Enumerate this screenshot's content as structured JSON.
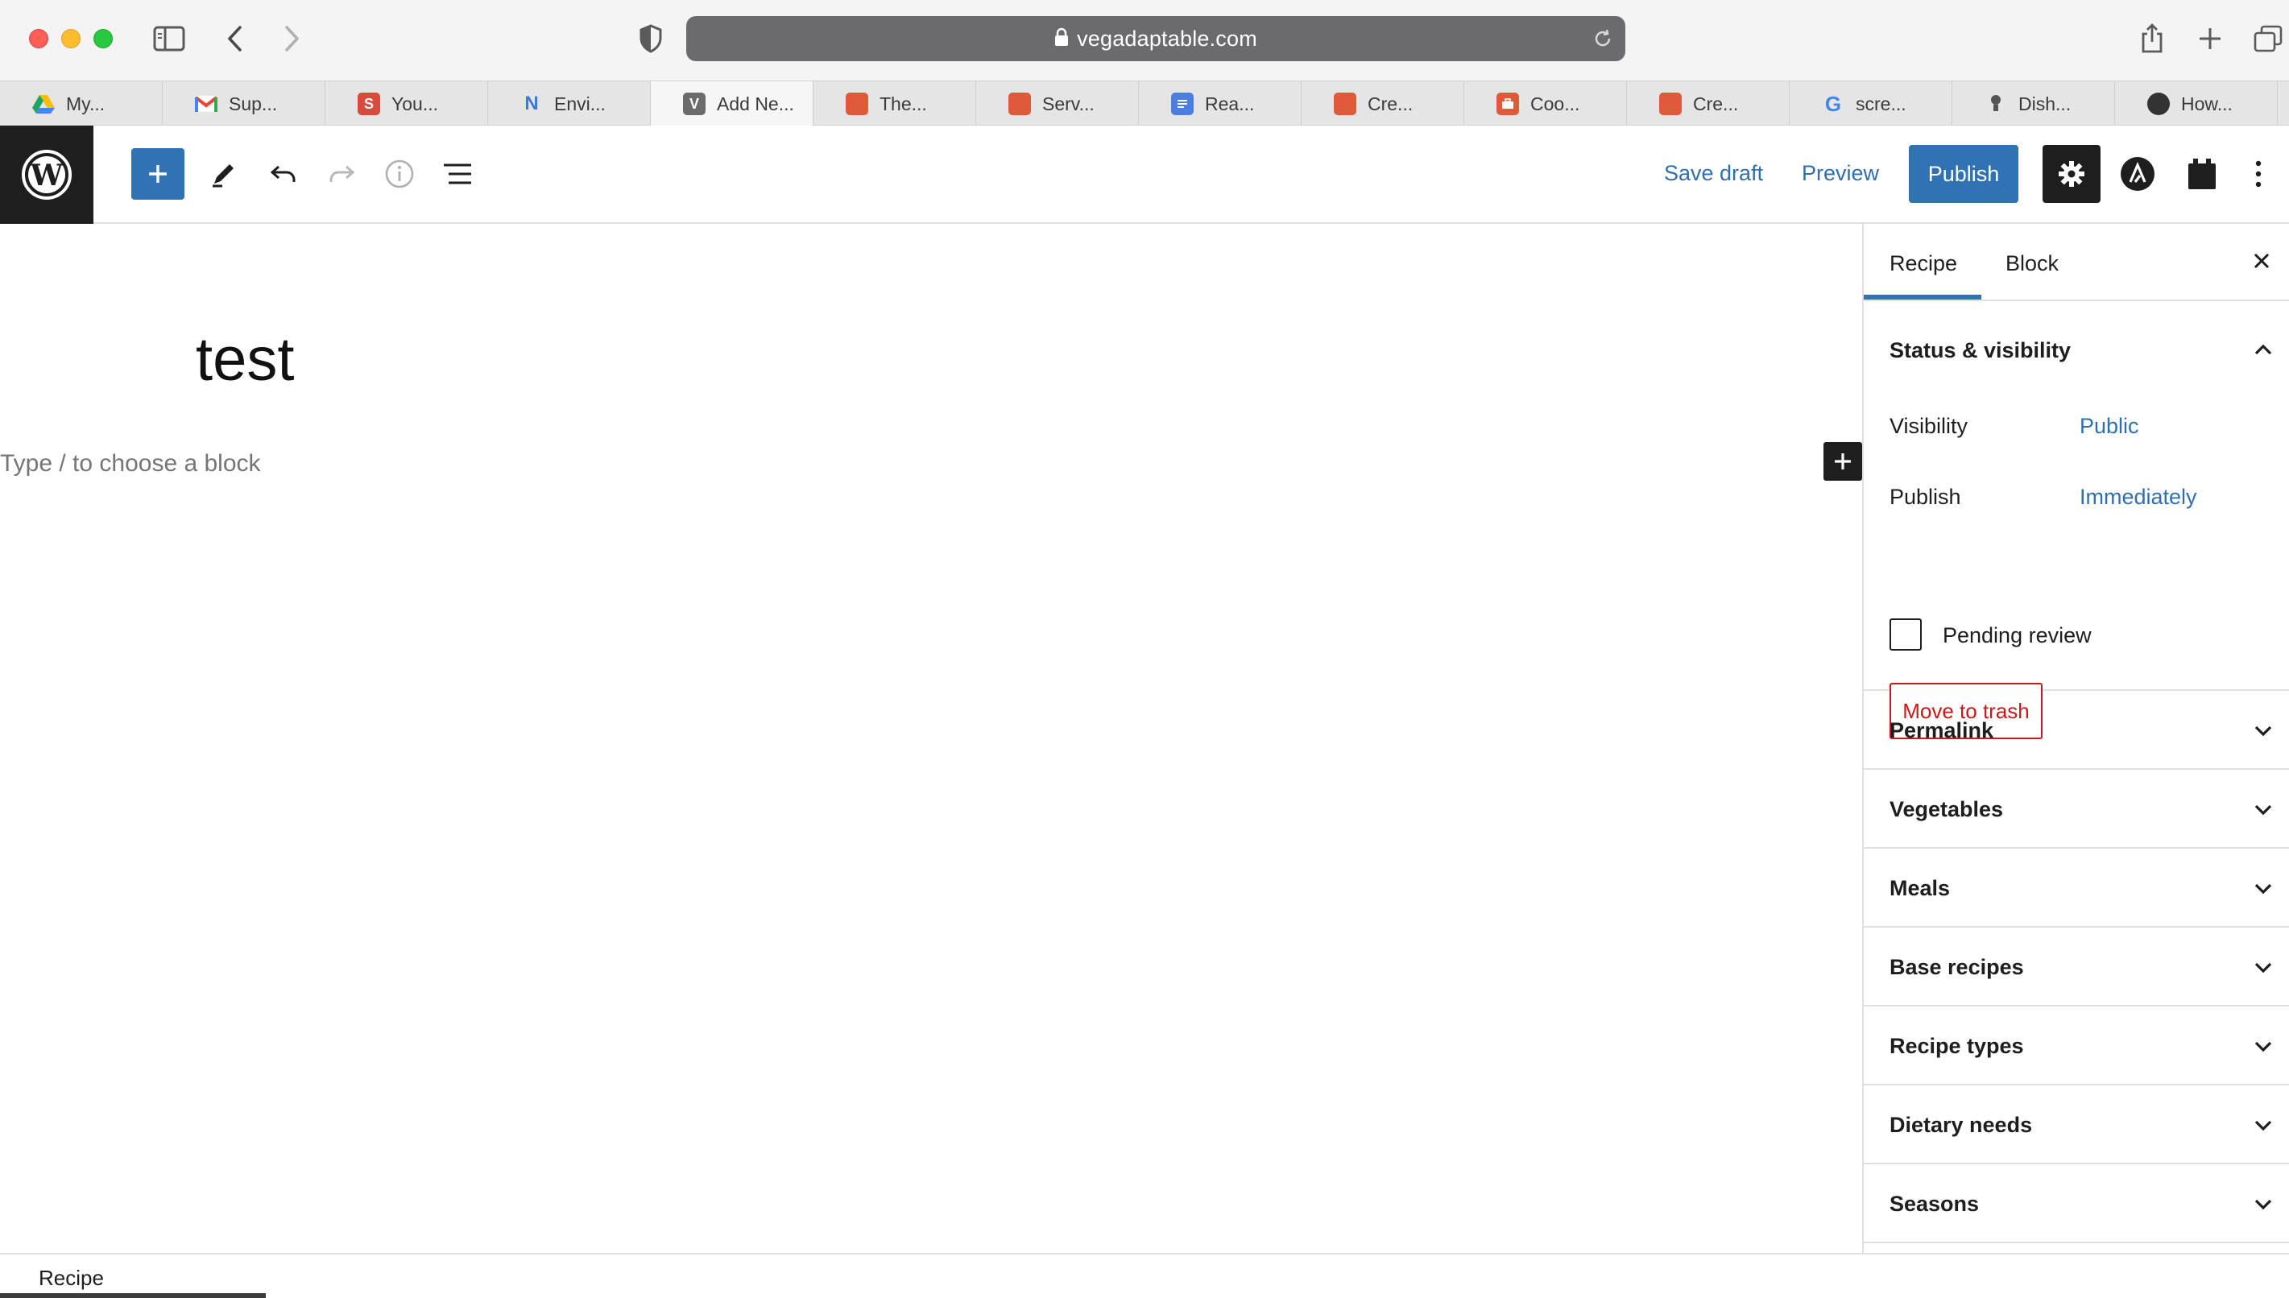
{
  "browser": {
    "url": "vegadaptable.com",
    "tabs": [
      {
        "label": "My...",
        "favicon": "google-drive-icon",
        "color": "#1fa463"
      },
      {
        "label": "Sup...",
        "favicon": "gmail-icon",
        "color": "#ea4335"
      },
      {
        "label": "You...",
        "favicon": "s-icon",
        "color": "#d94a3a"
      },
      {
        "label": "Envi...",
        "favicon": "n-icon",
        "color": "#3b7bd8"
      },
      {
        "label": "Add Ne...",
        "favicon": "v-icon",
        "color": "#6b6b6b"
      },
      {
        "label": "The...",
        "favicon": "calendar-icon",
        "color": "#e05a3a"
      },
      {
        "label": "Serv...",
        "favicon": "calendar-icon",
        "color": "#e05a3a"
      },
      {
        "label": "Rea...",
        "favicon": "docs-icon",
        "color": "#4a7ee3"
      },
      {
        "label": "Cre...",
        "favicon": "calendar-icon",
        "color": "#e05a3a"
      },
      {
        "label": "Coo...",
        "favicon": "briefcase-icon",
        "color": "#e05a3a"
      },
      {
        "label": "Cre...",
        "favicon": "calendar-icon",
        "color": "#e05a3a"
      },
      {
        "label": "scre...",
        "favicon": "google-icon",
        "color": "#4285f4"
      },
      {
        "label": "Dish...",
        "favicon": "bulb-icon",
        "color": "#555555"
      },
      {
        "label": "How...",
        "favicon": "circle-logo-icon",
        "color": "#333333"
      }
    ]
  },
  "header": {
    "save_draft": "Save draft",
    "preview": "Preview",
    "publish": "Publish"
  },
  "editor": {
    "title": "test",
    "placeholder": "Type / to choose a block"
  },
  "sidebar": {
    "tabs": [
      "Recipe",
      "Block"
    ],
    "status": {
      "title": "Status & visibility",
      "visibility_label": "Visibility",
      "visibility_value": "Public",
      "publish_label": "Publish",
      "publish_value": "Immediately",
      "pending_review": "Pending review",
      "move_to_trash": "Move to trash"
    },
    "panels": [
      "Permalink",
      "Vegetables",
      "Meals",
      "Base recipes",
      "Recipe types",
      "Dietary needs",
      "Seasons"
    ]
  },
  "footer": {
    "breadcrumb": "Recipe"
  },
  "colors": {
    "accent": "#3172b4",
    "danger": "#cc1818"
  }
}
